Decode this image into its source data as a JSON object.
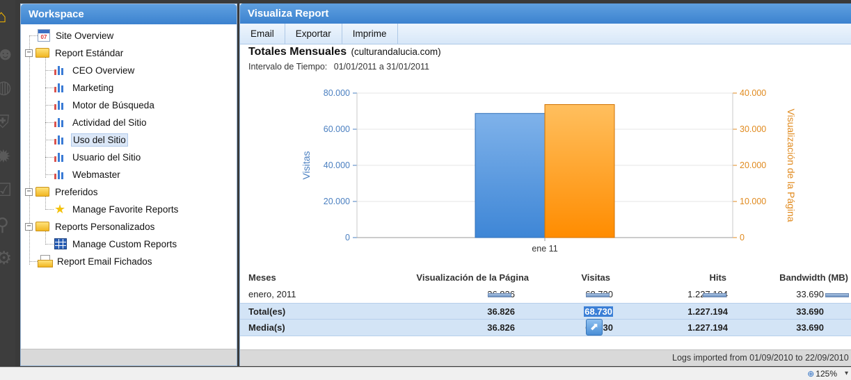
{
  "workspace": {
    "title": "Workspace",
    "tree": [
      {
        "label": "Site Overview",
        "icon": "calendar-icon",
        "cal_text": "07"
      },
      {
        "label": "Report Estándar",
        "icon": "folder-open-icon"
      },
      {
        "label": "CEO Overview",
        "icon": "bar-chart-icon"
      },
      {
        "label": "Marketing",
        "icon": "bar-chart-icon"
      },
      {
        "label": "Motor de Búsqueda",
        "icon": "bar-chart-icon"
      },
      {
        "label": "Actividad del Sitio",
        "icon": "bar-chart-icon"
      },
      {
        "label": "Uso del Sitio",
        "icon": "bar-chart-icon",
        "selected": true
      },
      {
        "label": "Usuario del Sitio",
        "icon": "bar-chart-icon"
      },
      {
        "label": "Webmaster",
        "icon": "bar-chart-icon"
      },
      {
        "label": "Preferidos",
        "icon": "folder-open-icon"
      },
      {
        "label": "Manage Favorite Reports",
        "icon": "star-icon"
      },
      {
        "label": "Reports Personalizados",
        "icon": "folder-open-icon"
      },
      {
        "label": "Manage Custom Reports",
        "icon": "grid-icon"
      },
      {
        "label": "Report Email Fichados",
        "icon": "document-folder-icon"
      }
    ],
    "expanders": [
      "−",
      "−",
      "−"
    ]
  },
  "report": {
    "title": "Visualiza Report",
    "toolbar": [
      "Email",
      "Exportar",
      "Imprime"
    ],
    "heading": "Totales Mensuales",
    "site": "(culturandalucia.com)",
    "interval_label": "Intervalo de Tiempo:",
    "interval_dates": "01/01/2011 a 31/01/2011",
    "footer": "Logs imported from 01/09/2010 to 22/09/2010"
  },
  "chart_data": {
    "type": "bar",
    "categories": [
      "ene 11"
    ],
    "series": [
      {
        "name": "Visitas",
        "values": [
          68730
        ],
        "axis": "left",
        "color": "#4a90d9"
      },
      {
        "name": "Visualización de la Página",
        "values": [
          36826
        ],
        "axis": "right",
        "color": "#ff9a1e"
      }
    ],
    "ylabel": "Visitas",
    "y2label": "Visualización de la Página",
    "ylim": [
      0,
      80000
    ],
    "y2lim": [
      0,
      40000
    ],
    "yticks": [
      "0",
      "20.000",
      "40.000",
      "60.000",
      "80.000"
    ],
    "y2ticks": [
      "0",
      "10.000",
      "20.000",
      "30.000",
      "40.000"
    ],
    "grid": true,
    "left_axis_color": "#4a7fc0",
    "right_axis_color": "#e08a1e"
  },
  "table": {
    "headers": [
      "Meses",
      "Visualización de la Página",
      "Visitas",
      "Hits",
      "Bandwidth (MB)"
    ],
    "rows": [
      {
        "name": "enero, 2011",
        "pv": "36.826",
        "vi": "68.730",
        "hi": "1.227.194",
        "bw": "33.690"
      }
    ],
    "total": {
      "name": "Total(es)",
      "pv": "36.826",
      "vi": "68.730",
      "hi": "1.227.194",
      "bw": "33.690"
    },
    "average": {
      "name": "Media(s)",
      "pv": "36.826",
      "vi": "68.730",
      "hi": "1.227.194",
      "bw": "33.690"
    }
  },
  "statusbar": {
    "zoom": "125%"
  }
}
